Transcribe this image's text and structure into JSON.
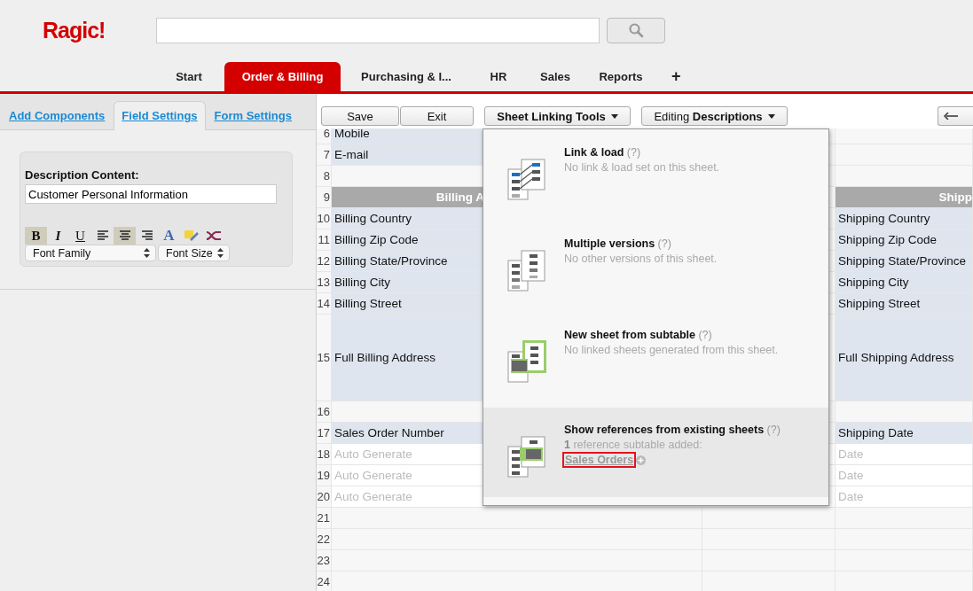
{
  "logo": "Ragic!",
  "nav_tabs": [
    {
      "label": "Start",
      "selected": false
    },
    {
      "label": "Order & Billing",
      "selected": true
    },
    {
      "label": "Purchasing & I...",
      "selected": false
    },
    {
      "label": "HR",
      "selected": false
    },
    {
      "label": "Sales",
      "selected": false
    },
    {
      "label": "Reports",
      "selected": false
    },
    {
      "label": "+",
      "selected": false
    }
  ],
  "side_tabs": [
    {
      "label": "Add Components",
      "selected": false
    },
    {
      "label": "Field Settings",
      "selected": true
    },
    {
      "label": "Form Settings",
      "selected": false
    }
  ],
  "description": {
    "label": "Description Content:",
    "value": "Customer Personal Information",
    "tools": [
      {
        "kind": "glyph",
        "label": "B",
        "active": true
      },
      {
        "kind": "glyph",
        "label": "I",
        "active": false
      },
      {
        "kind": "glyph",
        "label": "U",
        "active": false
      },
      {
        "kind": "icon",
        "active": false
      },
      {
        "kind": "icon",
        "active": true
      },
      {
        "kind": "icon",
        "active": false
      },
      {
        "kind": "glyph",
        "label": "A",
        "active": false
      },
      {
        "kind": "icon",
        "active": false
      },
      {
        "kind": "icon",
        "active": false
      }
    ],
    "selects": [
      "Font Family",
      "Font Size"
    ]
  },
  "toolbar": {
    "buttons": [
      "Save",
      "Exit"
    ],
    "menus": [
      "Sheet Linking Tools",
      "Editing **Descriptions**"
    ]
  },
  "grid": {
    "rows": [
      {
        "num": "6",
        "kind": "field",
        "a": "Mobile"
      },
      {
        "num": "7",
        "kind": "field",
        "a": "E-mail"
      },
      {
        "num": "8",
        "kind": "empty"
      },
      {
        "num": "9",
        "kind": "header",
        "a": "Billing A",
        "d": "Shipp"
      },
      {
        "num": "10",
        "kind": "field",
        "a": "Billing Country",
        "d": "Shipping Country"
      },
      {
        "num": "11",
        "kind": "field",
        "a": "Billing Zip Code",
        "d": "Shipping Zip Code"
      },
      {
        "num": "12",
        "kind": "field",
        "a": "Billing State/Province",
        "d": "Shipping State/Province"
      },
      {
        "num": "13",
        "kind": "field",
        "a": "Billing City",
        "d": "Shipping City"
      },
      {
        "num": "14",
        "kind": "field",
        "a": "Billing Street",
        "d": "Shipping Street"
      },
      {
        "num": "15",
        "kind": "tall",
        "a": "Full Billing Address",
        "d": "Full Shipping Address"
      },
      {
        "num": "16",
        "kind": "empty"
      },
      {
        "num": "17",
        "kind": "field",
        "a": "Sales Order Number",
        "d": "Shipping Date"
      },
      {
        "num": "18",
        "kind": "auto",
        "a": "Auto Generate",
        "d": "Date"
      },
      {
        "num": "19",
        "kind": "auto",
        "a": "Auto Generate",
        "d": "Date"
      },
      {
        "num": "20",
        "kind": "auto",
        "a": "Auto Generate",
        "d": "Date"
      },
      {
        "num": "21",
        "kind": "empty"
      },
      {
        "num": "22",
        "kind": "empty"
      },
      {
        "num": "23",
        "kind": "empty"
      },
      {
        "num": "24",
        "kind": "empty"
      }
    ]
  },
  "linking_menu": {
    "items": [
      {
        "kind": "link-load",
        "title": "Link & load",
        "help": "(?)",
        "desc": "No link & load set on this sheet.",
        "selected": false
      },
      {
        "kind": "versions",
        "title": "Multiple versions",
        "help": "(?)",
        "desc": "No other versions of this sheet.",
        "selected": false
      },
      {
        "kind": "subtable",
        "title": "New sheet from subtable",
        "help": "(?)",
        "desc": "No linked sheets generated from this sheet.",
        "selected": false
      },
      {
        "kind": "references",
        "title": "Show references from existing sheets",
        "help": "(?)",
        "desc": "**1** reference subtable added:",
        "link": "Sales Orders",
        "outlined": true,
        "selected": true
      }
    ]
  }
}
